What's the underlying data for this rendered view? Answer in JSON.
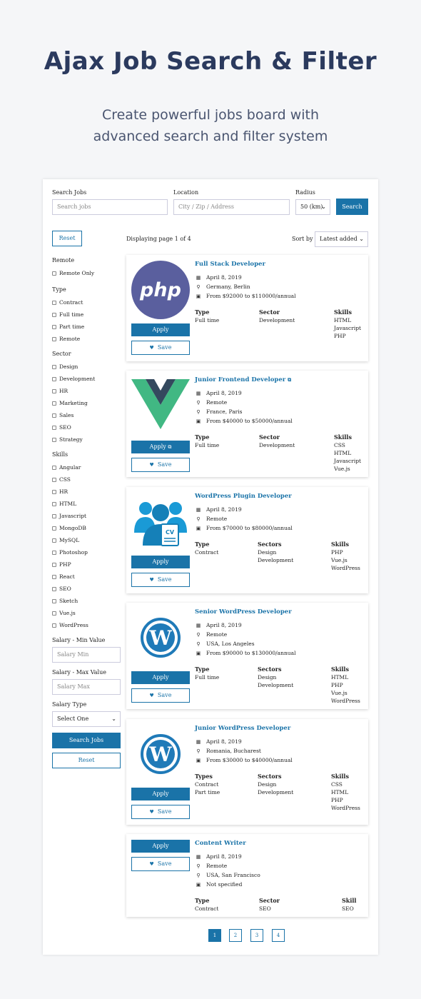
{
  "hero": {
    "title": "Ajax Job Search & Filter",
    "subtitle_line1": "Create powerful jobs board with",
    "subtitle_line2": "advanced search and filter system"
  },
  "search": {
    "jobs_label": "Search Jobs",
    "jobs_placeholder": "Search jobs",
    "location_label": "Location",
    "location_placeholder": "City / Zip / Address",
    "radius_label": "Radius",
    "radius_value": "50 (km)",
    "search_button": "Search"
  },
  "toolbar": {
    "reset_button": "Reset",
    "displaying": "Displaying page 1 of 4",
    "sort_label": "Sort by",
    "sort_value": "Latest added"
  },
  "filters": {
    "remote_heading": "Remote",
    "remote_options": [
      "Remote Only"
    ],
    "type_heading": "Type",
    "type_options": [
      "Contract",
      "Full time",
      "Part time",
      "Remote"
    ],
    "sector_heading": "Sector",
    "sector_options": [
      "Design",
      "Development",
      "HR",
      "Marketing",
      "Sales",
      "SEO",
      "Strategy"
    ],
    "skills_heading": "Skills",
    "skills_options": [
      "Angular",
      "CSS",
      "HR",
      "HTML",
      "Javascript",
      "MongoDB",
      "MySQL",
      "Photoshop",
      "PHP",
      "React",
      "SEO",
      "Sketch",
      "Vue.js",
      "WordPress"
    ],
    "salary_min_label": "Salary - Min Value",
    "salary_min_placeholder": "Salary Min",
    "salary_max_label": "Salary - Max Value",
    "salary_max_placeholder": "Salary Max",
    "salary_type_label": "Salary Type",
    "salary_type_value": "Select One",
    "search_jobs_button": "Search Jobs",
    "reset_button": "Reset"
  },
  "jobs": [
    {
      "title": "Full Stack Developer",
      "logo": "php-logo",
      "external": false,
      "meta": [
        "April 8, 2019",
        "Germany, Berlin",
        "From $92000 to $110000/annual"
      ],
      "type_heading": "Type",
      "types": [
        "Full time"
      ],
      "sector_heading": "Sector",
      "sectors": [
        "Development"
      ],
      "skills_heading": "Skills",
      "skills": [
        "HTML",
        "Javascript",
        "PHP"
      ],
      "apply": "Apply",
      "save": "Save"
    },
    {
      "title": "Junior Frontend Developer",
      "logo": "vue-logo",
      "external": true,
      "meta": [
        "April 8, 2019",
        "Remote",
        "France, Paris",
        "From $40000 to $50000/annual"
      ],
      "type_heading": "Type",
      "types": [
        "Full time"
      ],
      "sector_heading": "Sector",
      "sectors": [
        "Development"
      ],
      "skills_heading": "Skills",
      "skills": [
        "CSS",
        "HTML",
        "Javascript",
        "Vue.js"
      ],
      "apply": "Apply",
      "save": "Save"
    },
    {
      "title": "WordPress Plugin Developer",
      "logo": "cv-people-logo",
      "external": false,
      "meta": [
        "April 8, 2019",
        "Remote",
        "From $70000 to $80000/annual"
      ],
      "type_heading": "Type",
      "types": [
        "Contract"
      ],
      "sector_heading": "Sectors",
      "sectors": [
        "Design",
        "Development"
      ],
      "skills_heading": "Skills",
      "skills": [
        "PHP",
        "Vue.js",
        "WordPress"
      ],
      "apply": "Apply",
      "save": "Save"
    },
    {
      "title": "Senior WordPress Developer",
      "logo": "wordpress-logo",
      "external": false,
      "meta": [
        "April 8, 2019",
        "Remote",
        "USA, Los Angeles",
        "From $90000 to $130000/annual"
      ],
      "type_heading": "Type",
      "types": [
        "Full time"
      ],
      "sector_heading": "Sectors",
      "sectors": [
        "Design",
        "Development"
      ],
      "skills_heading": "Skills",
      "skills": [
        "HTML",
        "PHP",
        "Vue.js",
        "WordPress"
      ],
      "apply": "Apply",
      "save": "Save"
    },
    {
      "title": "Junior WordPress Developer",
      "logo": "wordpress-logo",
      "external": false,
      "meta": [
        "April 8, 2019",
        "Romania, Bucharest",
        "From $30000 to $40000/annual"
      ],
      "type_heading": "Types",
      "types": [
        "Contract",
        "Part time"
      ],
      "sector_heading": "Sectors",
      "sectors": [
        "Design",
        "Development"
      ],
      "skills_heading": "Skills",
      "skills": [
        "CSS",
        "HTML",
        "PHP",
        "WordPress"
      ],
      "apply": "Apply",
      "save": "Save"
    },
    {
      "title": "Content Writer",
      "logo": "",
      "external": false,
      "meta": [
        "April 8, 2019",
        "Remote",
        "USA, San Francisco",
        "Not specified"
      ],
      "type_heading": "Type",
      "types": [
        "Contract"
      ],
      "sector_heading": "Sector",
      "sectors": [
        "SEO"
      ],
      "skills_heading": "Skill",
      "skills": [
        "SEO"
      ],
      "apply": "Apply",
      "save": "Save"
    }
  ],
  "pagination": [
    "1",
    "2",
    "3",
    "4"
  ],
  "colors": {
    "accent": "#1a73a8",
    "heading": "#2b3a5e",
    "php": "#5a5f9e",
    "vue_green": "#41b883",
    "vue_dark": "#34495e",
    "wp_blue": "#1f7ab8",
    "cv_blue": "#1a9ad6"
  }
}
